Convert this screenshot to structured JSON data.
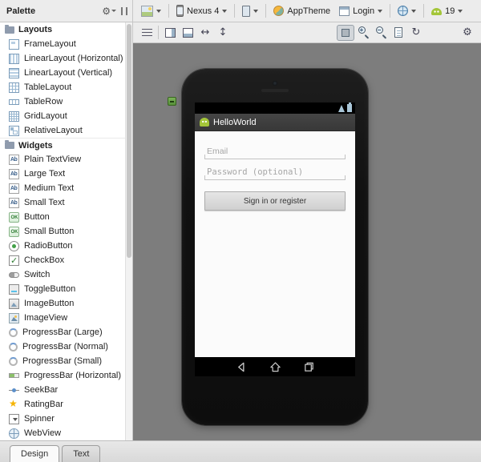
{
  "palette": {
    "title": "Palette",
    "sections": [
      {
        "label": "Layouts",
        "items": [
          {
            "label": "FrameLayout",
            "icon": "framelayout-icon"
          },
          {
            "label": "LinearLayout (Horizontal)",
            "icon": "linearlayout-horizontal-icon"
          },
          {
            "label": "LinearLayout (Vertical)",
            "icon": "linearlayout-vertical-icon"
          },
          {
            "label": "TableLayout",
            "icon": "tablelayout-icon"
          },
          {
            "label": "TableRow",
            "icon": "tablerow-icon"
          },
          {
            "label": "GridLayout",
            "icon": "gridlayout-icon"
          },
          {
            "label": "RelativeLayout",
            "icon": "relativelayout-icon"
          }
        ]
      },
      {
        "label": "Widgets",
        "items": [
          {
            "label": "Plain TextView",
            "icon": "textview-icon"
          },
          {
            "label": "Large Text",
            "icon": "textview-icon"
          },
          {
            "label": "Medium Text",
            "icon": "textview-icon"
          },
          {
            "label": "Small Text",
            "icon": "textview-icon"
          },
          {
            "label": "Button",
            "icon": "button-icon"
          },
          {
            "label": "Small Button",
            "icon": "button-icon"
          },
          {
            "label": "RadioButton",
            "icon": "radiobutton-icon"
          },
          {
            "label": "CheckBox",
            "icon": "checkbox-icon"
          },
          {
            "label": "Switch",
            "icon": "switch-icon"
          },
          {
            "label": "ToggleButton",
            "icon": "togglebutton-icon"
          },
          {
            "label": "ImageButton",
            "icon": "imagebutton-icon"
          },
          {
            "label": "ImageView",
            "icon": "imageview-icon"
          },
          {
            "label": "ProgressBar (Large)",
            "icon": "progressbar-circular-icon"
          },
          {
            "label": "ProgressBar (Normal)",
            "icon": "progressbar-circular-icon"
          },
          {
            "label": "ProgressBar (Small)",
            "icon": "progressbar-circular-icon"
          },
          {
            "label": "ProgressBar (Horizontal)",
            "icon": "progressbar-horizontal-icon"
          },
          {
            "label": "SeekBar",
            "icon": "seekbar-icon"
          },
          {
            "label": "RatingBar",
            "icon": "ratingbar-icon"
          },
          {
            "label": "Spinner",
            "icon": "spinner-icon"
          },
          {
            "label": "WebView",
            "icon": "webview-icon"
          }
        ]
      }
    ]
  },
  "toolbar": {
    "device_label": "Nexus 4",
    "theme_label": "AppTheme",
    "activity_label": "Login",
    "api_label": "19"
  },
  "device_screen": {
    "app_title": "HelloWorld",
    "email_placeholder": "Email",
    "password_placeholder": "Password (optional)",
    "signin_label": "Sign in or register"
  },
  "tabs": {
    "design": "Design",
    "text": "Text"
  },
  "icons": {
    "gear": "⚙",
    "refresh": "↻",
    "expand_h": "↔",
    "expand_v": "↕"
  },
  "colors": {
    "canvas_bg": "#7d7d7d",
    "panel_bg": "#ececec",
    "android_green": "#a4c639",
    "status_icon_blue": "#a9c6d8"
  }
}
